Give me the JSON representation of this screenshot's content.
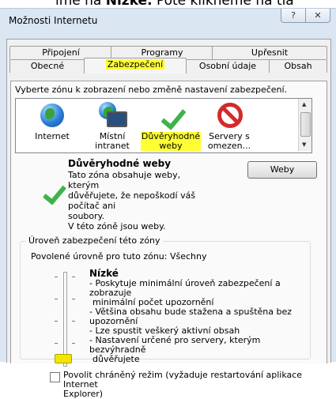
{
  "crop_text": "ime na ",
  "crop_text_bold": "Nízké.",
  "crop_text_tail": " Poté klikneme na tla",
  "window": {
    "title": "Možnosti Internetu",
    "help_glyph": "?",
    "close_glyph": "✕"
  },
  "tabs": {
    "row1": [
      "Připojení",
      "Programy",
      "Upřesnit"
    ],
    "row2": [
      "Obecné",
      "Zabezpečení",
      "Osobní údaje",
      "Obsah"
    ]
  },
  "instruction": "Vyberte zónu k zobrazení nebo změně nastavení zabezpečení.",
  "zones": [
    {
      "label": "Internet",
      "icon": "globe-icon"
    },
    {
      "label": "Místní intranet",
      "icon": "intranet-icon"
    },
    {
      "label": "Důvěryhodné weby",
      "icon": "trusted-check-icon"
    },
    {
      "label": "Servery s omezen...",
      "icon": "restricted-icon"
    }
  ],
  "selected_zone": {
    "name": "Důvěryhodné weby",
    "description": [
      "Tato zóna obsahuje weby, kterým",
      "důvěřujete, že nepoškodí váš počítač ani",
      "soubory.",
      "V této zóně jsou weby."
    ],
    "button": "Weby"
  },
  "security_level": {
    "group_title": "Úroveň zabezpečení této zóny",
    "allowed": "Povolené úrovně pro tuto zónu: Všechny",
    "level_name": "Nízké",
    "bullets": [
      "- Poskytuje minimální úroveň zabezpečení a zobrazuje",
      "minimální počet upozornění",
      "- Většina obsahu bude stažena a spuštěna bez upozornění",
      "- Lze spustit veškerý aktivní obsah",
      "- Nastavení určené pro servery, kterým bezvýhradně",
      "důvěřujete"
    ],
    "slider_level": "Nízké"
  },
  "protected_mode": {
    "label_line1": "Povolit chráněný režim (vyžaduje restartování aplikace Internet",
    "label_line2": "Explorer)",
    "checked": false
  },
  "colors": {
    "highlight": "#ffff33",
    "check_green": "#3fb34a",
    "no_red": "#d42a2a"
  }
}
